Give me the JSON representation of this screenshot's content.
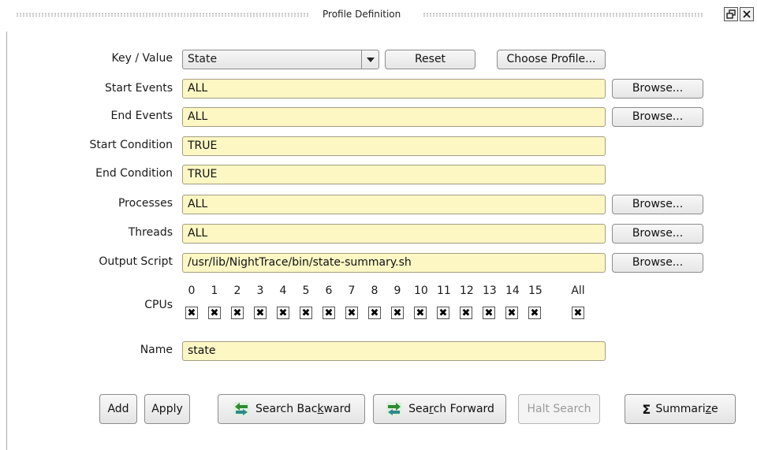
{
  "window": {
    "title": "Profile Definition",
    "restore_icon": "restore-window-icon",
    "close_icon": "close-window-icon"
  },
  "key_value": {
    "label": "Key / Value",
    "selected": "State",
    "reset_label": "Reset",
    "choose_profile_label": "Choose Profile..."
  },
  "fields": {
    "start_events": {
      "label": "Start Events",
      "value": "ALL",
      "browse": "Browse..."
    },
    "end_events": {
      "label": "End Events",
      "value": "ALL",
      "browse": "Browse..."
    },
    "start_condition": {
      "label": "Start Condition",
      "value": "TRUE"
    },
    "end_condition": {
      "label": "End Condition",
      "value": "TRUE"
    },
    "processes": {
      "label": "Processes",
      "value": "ALL",
      "browse": "Browse..."
    },
    "threads": {
      "label": "Threads",
      "value": "ALL",
      "browse": "Browse..."
    },
    "output_script": {
      "label": "Output Script",
      "value": "/usr/lib/NightTrace/bin/state-summary.sh",
      "browse": "Browse..."
    }
  },
  "cpus": {
    "label": "CPUs",
    "items": [
      {
        "label": "0",
        "checked": true
      },
      {
        "label": "1",
        "checked": true
      },
      {
        "label": "2",
        "checked": true
      },
      {
        "label": "3",
        "checked": true
      },
      {
        "label": "4",
        "checked": true
      },
      {
        "label": "5",
        "checked": true
      },
      {
        "label": "6",
        "checked": true
      },
      {
        "label": "7",
        "checked": true
      },
      {
        "label": "8",
        "checked": true
      },
      {
        "label": "9",
        "checked": true
      },
      {
        "label": "10",
        "checked": true
      },
      {
        "label": "11",
        "checked": true
      },
      {
        "label": "12",
        "checked": true
      },
      {
        "label": "13",
        "checked": true
      },
      {
        "label": "14",
        "checked": true
      },
      {
        "label": "15",
        "checked": true
      }
    ],
    "all": {
      "label": "All",
      "checked": true
    },
    "check_mark": "✖"
  },
  "name": {
    "label": "Name",
    "value": "state"
  },
  "actions": {
    "add": "Add",
    "apply": "Apply",
    "search_backward_pre": "Search Bac",
    "search_backward_key": "k",
    "search_backward_post": "ward",
    "search_forward_pre": "Sea",
    "search_forward_key": "r",
    "search_forward_post": "ch Forward",
    "halt_search": "Halt Search",
    "summarize_pre": "Summari",
    "summarize_key": "z",
    "summarize_post": "e",
    "summarize_symbol": "Σ"
  },
  "colors": {
    "field_bg": "#fdf7c4",
    "arrow_green": "#2e8b2e",
    "arrow_teal": "#2f8a8a"
  }
}
